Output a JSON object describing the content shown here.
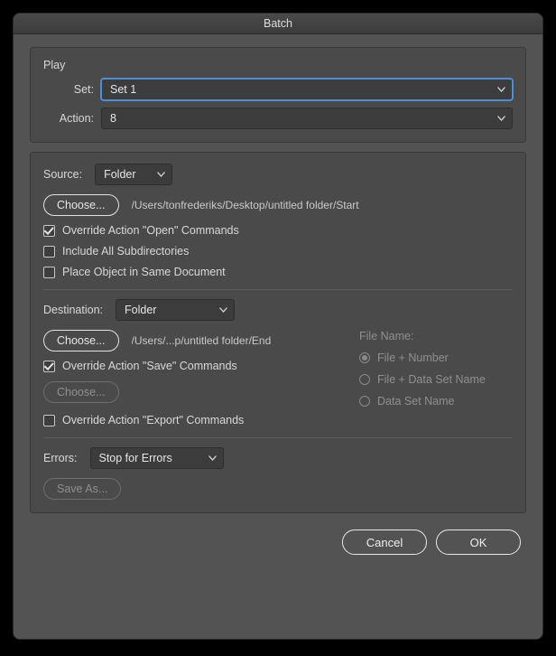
{
  "window": {
    "title": "Batch"
  },
  "play": {
    "heading": "Play",
    "set_label": "Set:",
    "set_value": "Set 1",
    "action_label": "Action:",
    "action_value": "8"
  },
  "source": {
    "label": "Source:",
    "value": "Folder",
    "choose_label": "Choose...",
    "path": "/Users/tonfrederiks/Desktop/untitled folder/Start",
    "override_open": "Override Action \"Open\" Commands",
    "include_subdirs": "Include All Subdirectories",
    "place_object": "Place Object in Same Document"
  },
  "destination": {
    "label": "Destination:",
    "value": "Folder",
    "choose_label": "Choose...",
    "path": "/Users/...p/untitled folder/End",
    "override_save": "Override Action \"Save\" Commands",
    "choose2_label": "Choose...",
    "override_export": "Override Action \"Export\" Commands",
    "filename_label": "File Name:",
    "opt_number": "File + Number",
    "opt_dataset": "File + Data Set Name",
    "opt_dataonly": "Data Set Name"
  },
  "errors": {
    "label": "Errors:",
    "value": "Stop for Errors",
    "saveas_label": "Save As..."
  },
  "footer": {
    "cancel": "Cancel",
    "ok": "OK"
  }
}
